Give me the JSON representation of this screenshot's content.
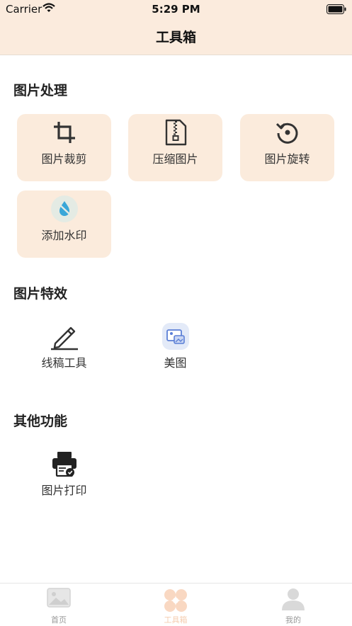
{
  "status_bar": {
    "carrier": "Carrier",
    "time": "5:29 PM"
  },
  "nav": {
    "title": "工具箱"
  },
  "sections": [
    {
      "title": "图片处理",
      "items": [
        {
          "label": "图片裁剪",
          "icon": "crop-icon"
        },
        {
          "label": "压缩图片",
          "icon": "zip-file-icon"
        },
        {
          "label": "图片旋转",
          "icon": "rotate-icon"
        },
        {
          "label": "添加水印",
          "icon": "water-drop-icon"
        }
      ]
    },
    {
      "title": "图片特效",
      "items": [
        {
          "label": "线稿工具",
          "icon": "pencil-icon"
        },
        {
          "label": "美图",
          "icon": "photo-icon"
        }
      ]
    },
    {
      "title": "其他功能",
      "items": [
        {
          "label": "图片打印",
          "icon": "printer-icon"
        }
      ]
    }
  ],
  "tabbar": {
    "active": "工具箱",
    "items": [
      {
        "label": "首页",
        "icon": "image-icon"
      },
      {
        "label": "工具箱",
        "icon": "clover-icon"
      },
      {
        "label": "我的",
        "icon": "user-icon"
      }
    ]
  },
  "colors": {
    "header_bg": "#fbebdd",
    "card_bg": "#fbebdc",
    "active_tab": "#f5cdb0",
    "inactive_tab": "#999999"
  }
}
